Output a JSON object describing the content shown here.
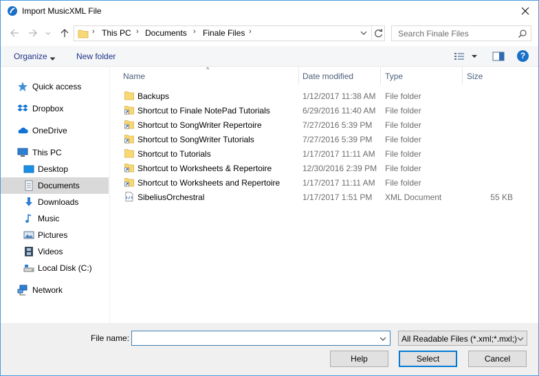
{
  "window": {
    "title": "Import MusicXML File"
  },
  "address": {
    "crumbs": [
      "This PC",
      "Documents",
      "Finale Files"
    ]
  },
  "search": {
    "placeholder": "Search Finale Files"
  },
  "toolbar": {
    "organize": "Organize",
    "new_folder": "New folder"
  },
  "sidebar": {
    "items": [
      {
        "label": "Quick access",
        "icon": "star-icon"
      },
      {
        "label": "Dropbox",
        "icon": "dropbox-icon"
      },
      {
        "label": "OneDrive",
        "icon": "cloud-icon"
      },
      {
        "label": "This PC",
        "icon": "computer-icon"
      },
      {
        "label": "Desktop",
        "icon": "desktop-icon"
      },
      {
        "label": "Documents",
        "icon": "documents-icon",
        "selected": true
      },
      {
        "label": "Downloads",
        "icon": "download-arrow-icon"
      },
      {
        "label": "Music",
        "icon": "music-note-icon"
      },
      {
        "label": "Pictures",
        "icon": "pictures-icon"
      },
      {
        "label": "Videos",
        "icon": "film-icon"
      },
      {
        "label": "Local Disk (C:)",
        "icon": "disk-icon"
      },
      {
        "label": "Network",
        "icon": "network-icon"
      }
    ]
  },
  "columns": {
    "name": "Name",
    "date": "Date modified",
    "type": "Type",
    "size": "Size"
  },
  "files": [
    {
      "name": "Backups",
      "date": "1/12/2017 11:38 AM",
      "type": "File folder",
      "size": "",
      "icon": "folder-icon"
    },
    {
      "name": "Shortcut to Finale NotePad Tutorials",
      "date": "6/29/2016 11:40 AM",
      "type": "File folder",
      "size": "",
      "icon": "folder-shortcut-icon"
    },
    {
      "name": "Shortcut to SongWriter Repertoire",
      "date": "7/27/2016 5:39 PM",
      "type": "File folder",
      "size": "",
      "icon": "folder-shortcut-icon"
    },
    {
      "name": "Shortcut to SongWriter Tutorials",
      "date": "7/27/2016 5:39 PM",
      "type": "File folder",
      "size": "",
      "icon": "folder-shortcut-icon"
    },
    {
      "name": "Shortcut to Tutorials",
      "date": "1/17/2017 11:11 AM",
      "type": "File folder",
      "size": "",
      "icon": "folder-icon"
    },
    {
      "name": "Shortcut to Worksheets & Repertoire",
      "date": "12/30/2016 2:39 PM",
      "type": "File folder",
      "size": "",
      "icon": "folder-shortcut-icon"
    },
    {
      "name": "Shortcut to Worksheets and Repertoire",
      "date": "1/17/2017 11:11 AM",
      "type": "File folder",
      "size": "",
      "icon": "folder-shortcut-icon"
    },
    {
      "name": "SibeliusOrchestral",
      "date": "1/17/2017 1:51 PM",
      "type": "XML Document",
      "size": "55 KB",
      "icon": "xml-document-icon"
    }
  ],
  "footer": {
    "file_name_label": "File name:",
    "file_name_value": "",
    "filter": "All Readable Files (*.xml;*.mxl;)",
    "help": "Help",
    "select": "Select",
    "cancel": "Cancel"
  },
  "colors": {
    "accent": "#0078d7",
    "folder": "#f8d775",
    "link": "#1e3287"
  }
}
